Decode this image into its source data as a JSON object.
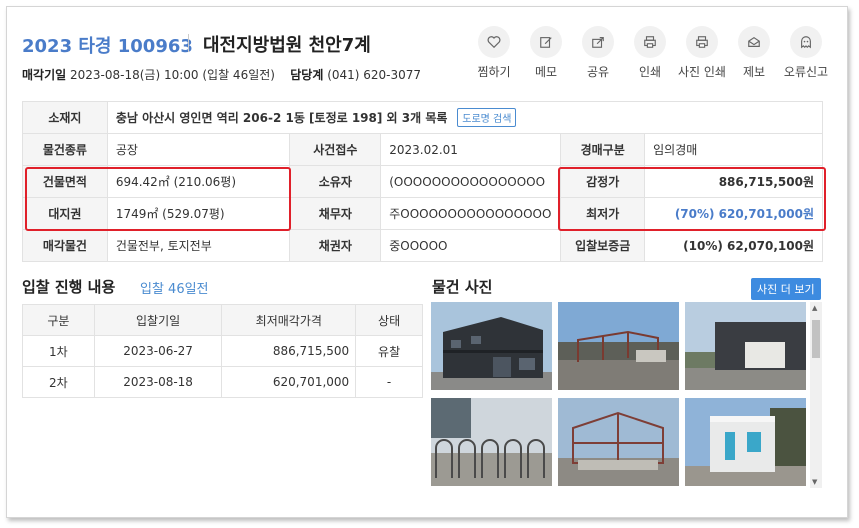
{
  "header": {
    "case_number": "2023 타경 100963",
    "court": "대전지방법원 천안7계",
    "sale_date_label": "매각기일",
    "sale_date_value": "2023-08-18(금) 10:00 (입찰 46일전)",
    "contact_label": "담당계",
    "contact_value": "(041) 620-3077"
  },
  "toolbar": {
    "items": [
      {
        "label": "찜하기",
        "icon": "heart-icon"
      },
      {
        "label": "메모",
        "icon": "pencil-icon"
      },
      {
        "label": "공유",
        "icon": "share-icon"
      },
      {
        "label": "인쇄",
        "icon": "printer-icon"
      },
      {
        "label": "사진 인쇄",
        "icon": "printer-icon"
      },
      {
        "label": "제보",
        "icon": "envelope-icon"
      },
      {
        "label": "오류신고",
        "icon": "ghost-icon"
      }
    ]
  },
  "info": {
    "location_label": "소재지",
    "location_value": "충남 아산시 영인면 역리 206-2 1동 [토정로 198] 외 3개 목록",
    "road_search": "도로명 검색",
    "type_label": "물건종류",
    "type_value": "공장",
    "received_label": "사건접수",
    "received_value": "2023.02.01",
    "auction_kind_label": "경매구분",
    "auction_kind_value": "임의경매",
    "building_area_label": "건물면적",
    "building_area_value": "694.42㎡ (210.06평)",
    "owner_label": "소유자",
    "owner_value": "(OOOOOOOOOOOOOOOO",
    "appraisal_label": "감정가",
    "appraisal_value": "886,715,500원",
    "land_right_label": "대지권",
    "land_right_value": "1749㎡ (529.07평)",
    "debtor_label": "채무자",
    "debtor_value": "주OOOOOOOOOOOOOOOO",
    "minimum_label": "최저가",
    "minimum_value": "(70%) 620,701,000원",
    "sale_items_label": "매각물건",
    "sale_items_value": "건물전부, 토지전부",
    "creditor_label": "채권자",
    "creditor_value": "중OOOOO",
    "deposit_label": "입찰보증금",
    "deposit_value": "(10%) 62,070,100원"
  },
  "bid_section": {
    "title": "입찰 진행 내용",
    "subtitle": "입찰 46일전",
    "headers": [
      "구분",
      "입찰기일",
      "최저매각가격",
      "상태"
    ],
    "rows": [
      [
        "1차",
        "2023-06-27",
        "886,715,500",
        "유찰"
      ],
      [
        "2차",
        "2023-08-18",
        "620,701,000",
        "-"
      ]
    ]
  },
  "photo_section": {
    "title": "물건 사진",
    "more_button": "사진 더 보기"
  },
  "colors": {
    "accent": "#4a7cc9",
    "highlight_border": "#e0202a",
    "button": "#3d8be0"
  }
}
